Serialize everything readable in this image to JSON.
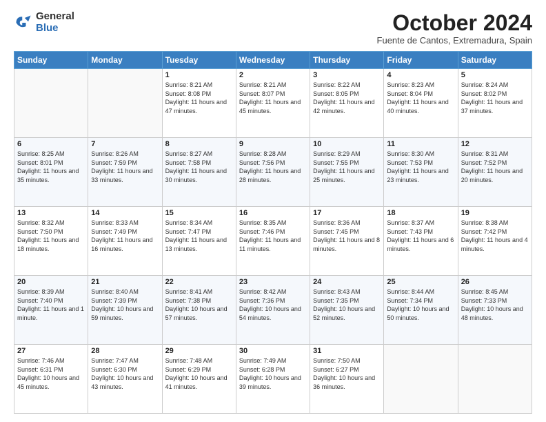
{
  "header": {
    "logo_general": "General",
    "logo_blue": "Blue",
    "month_title": "October 2024",
    "subtitle": "Fuente de Cantos, Extremadura, Spain"
  },
  "weekdays": [
    "Sunday",
    "Monday",
    "Tuesday",
    "Wednesday",
    "Thursday",
    "Friday",
    "Saturday"
  ],
  "weeks": [
    [
      {
        "day": "",
        "info": ""
      },
      {
        "day": "",
        "info": ""
      },
      {
        "day": "1",
        "info": "Sunrise: 8:21 AM\nSunset: 8:08 PM\nDaylight: 11 hours and 47 minutes."
      },
      {
        "day": "2",
        "info": "Sunrise: 8:21 AM\nSunset: 8:07 PM\nDaylight: 11 hours and 45 minutes."
      },
      {
        "day": "3",
        "info": "Sunrise: 8:22 AM\nSunset: 8:05 PM\nDaylight: 11 hours and 42 minutes."
      },
      {
        "day": "4",
        "info": "Sunrise: 8:23 AM\nSunset: 8:04 PM\nDaylight: 11 hours and 40 minutes."
      },
      {
        "day": "5",
        "info": "Sunrise: 8:24 AM\nSunset: 8:02 PM\nDaylight: 11 hours and 37 minutes."
      }
    ],
    [
      {
        "day": "6",
        "info": "Sunrise: 8:25 AM\nSunset: 8:01 PM\nDaylight: 11 hours and 35 minutes."
      },
      {
        "day": "7",
        "info": "Sunrise: 8:26 AM\nSunset: 7:59 PM\nDaylight: 11 hours and 33 minutes."
      },
      {
        "day": "8",
        "info": "Sunrise: 8:27 AM\nSunset: 7:58 PM\nDaylight: 11 hours and 30 minutes."
      },
      {
        "day": "9",
        "info": "Sunrise: 8:28 AM\nSunset: 7:56 PM\nDaylight: 11 hours and 28 minutes."
      },
      {
        "day": "10",
        "info": "Sunrise: 8:29 AM\nSunset: 7:55 PM\nDaylight: 11 hours and 25 minutes."
      },
      {
        "day": "11",
        "info": "Sunrise: 8:30 AM\nSunset: 7:53 PM\nDaylight: 11 hours and 23 minutes."
      },
      {
        "day": "12",
        "info": "Sunrise: 8:31 AM\nSunset: 7:52 PM\nDaylight: 11 hours and 20 minutes."
      }
    ],
    [
      {
        "day": "13",
        "info": "Sunrise: 8:32 AM\nSunset: 7:50 PM\nDaylight: 11 hours and 18 minutes."
      },
      {
        "day": "14",
        "info": "Sunrise: 8:33 AM\nSunset: 7:49 PM\nDaylight: 11 hours and 16 minutes."
      },
      {
        "day": "15",
        "info": "Sunrise: 8:34 AM\nSunset: 7:47 PM\nDaylight: 11 hours and 13 minutes."
      },
      {
        "day": "16",
        "info": "Sunrise: 8:35 AM\nSunset: 7:46 PM\nDaylight: 11 hours and 11 minutes."
      },
      {
        "day": "17",
        "info": "Sunrise: 8:36 AM\nSunset: 7:45 PM\nDaylight: 11 hours and 8 minutes."
      },
      {
        "day": "18",
        "info": "Sunrise: 8:37 AM\nSunset: 7:43 PM\nDaylight: 11 hours and 6 minutes."
      },
      {
        "day": "19",
        "info": "Sunrise: 8:38 AM\nSunset: 7:42 PM\nDaylight: 11 hours and 4 minutes."
      }
    ],
    [
      {
        "day": "20",
        "info": "Sunrise: 8:39 AM\nSunset: 7:40 PM\nDaylight: 11 hours and 1 minute."
      },
      {
        "day": "21",
        "info": "Sunrise: 8:40 AM\nSunset: 7:39 PM\nDaylight: 10 hours and 59 minutes."
      },
      {
        "day": "22",
        "info": "Sunrise: 8:41 AM\nSunset: 7:38 PM\nDaylight: 10 hours and 57 minutes."
      },
      {
        "day": "23",
        "info": "Sunrise: 8:42 AM\nSunset: 7:36 PM\nDaylight: 10 hours and 54 minutes."
      },
      {
        "day": "24",
        "info": "Sunrise: 8:43 AM\nSunset: 7:35 PM\nDaylight: 10 hours and 52 minutes."
      },
      {
        "day": "25",
        "info": "Sunrise: 8:44 AM\nSunset: 7:34 PM\nDaylight: 10 hours and 50 minutes."
      },
      {
        "day": "26",
        "info": "Sunrise: 8:45 AM\nSunset: 7:33 PM\nDaylight: 10 hours and 48 minutes."
      }
    ],
    [
      {
        "day": "27",
        "info": "Sunrise: 7:46 AM\nSunset: 6:31 PM\nDaylight: 10 hours and 45 minutes."
      },
      {
        "day": "28",
        "info": "Sunrise: 7:47 AM\nSunset: 6:30 PM\nDaylight: 10 hours and 43 minutes."
      },
      {
        "day": "29",
        "info": "Sunrise: 7:48 AM\nSunset: 6:29 PM\nDaylight: 10 hours and 41 minutes."
      },
      {
        "day": "30",
        "info": "Sunrise: 7:49 AM\nSunset: 6:28 PM\nDaylight: 10 hours and 39 minutes."
      },
      {
        "day": "31",
        "info": "Sunrise: 7:50 AM\nSunset: 6:27 PM\nDaylight: 10 hours and 36 minutes."
      },
      {
        "day": "",
        "info": ""
      },
      {
        "day": "",
        "info": ""
      }
    ]
  ]
}
